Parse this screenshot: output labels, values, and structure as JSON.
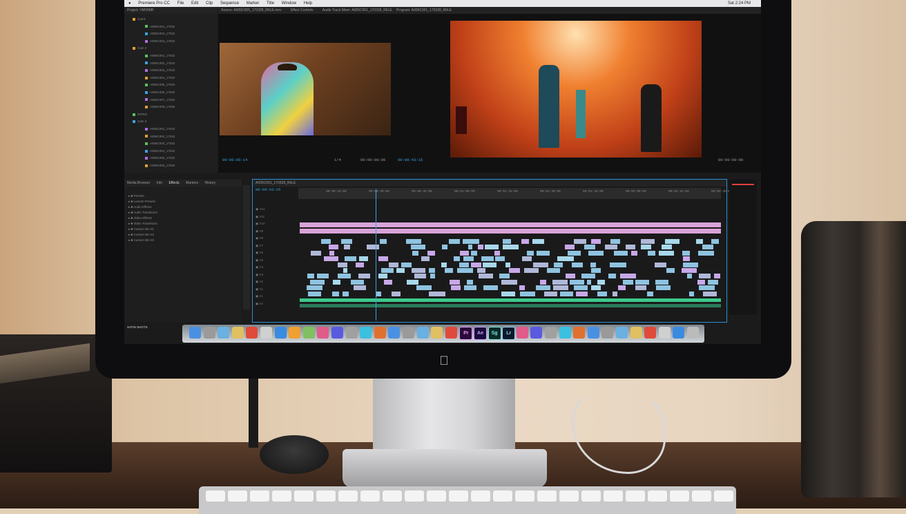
{
  "menubar": {
    "app_name": "Premiere Pro CC",
    "menus": [
      "File",
      "Edit",
      "Clip",
      "Sequence",
      "Marker",
      "Title",
      "Window",
      "Help"
    ],
    "clock": "Sat 2:24 PM"
  },
  "source_panel": {
    "tabs": [
      "Source: A005C005_170328_R6LE.mov",
      "Effect Controls",
      "Audio Track Mixer: A005C001_170328_R6LE"
    ],
    "timecode_left": "00:00:05:14",
    "timecode_right": "00:00:00:00",
    "page_fraction": "1/4"
  },
  "program_panel": {
    "title": "Program: A005C001_170328_R6LE",
    "timecode_left": "00:00:43:15",
    "timecode_right": "00:00:00:00"
  },
  "project_panel": {
    "title": "Project: VMV0MF",
    "items": [
      "Cam1",
      "A005C001_17032",
      "A005C002_17032",
      "A005C003_17032",
      "Cam 2",
      "A005C001_17032",
      "A005C002_17032",
      "A005C003_17032",
      "A005C004_17032",
      "A005C005_17032",
      "A005C006_17032",
      "A005C007_17032",
      "A005C008_17032",
      "INTRO",
      "Cam 3",
      "A005C001_17032",
      "A005C002_17032",
      "A005C003_17032",
      "A005C004_17032",
      "A005C005_17032",
      "A005C006_17032"
    ]
  },
  "lower_tabs": [
    "Media Browser",
    "Info",
    "Effects",
    "Markers",
    "History"
  ],
  "effects_list": [
    "Presets",
    "Lumetri Presets",
    "Audio Effects",
    "Audio Transitions",
    "Video Effects",
    "Video Transitions",
    "Custom Bin 01",
    "Custom Bin 02",
    "Custom Bin 03"
  ],
  "timeline": {
    "tab": "A005C001_170328_R6LE",
    "timecode": "00:00:43:15",
    "ruler_labels": [
      "00:00:15:00",
      "00:00:30:00",
      "00:00:45:00",
      "00:01:00:00",
      "00:01:15:00",
      "00:01:30:00",
      "00:01:45:00",
      "00:02:00:00",
      "00:02:15:00",
      "00:02:30:00"
    ],
    "track_labels": [
      "V12",
      "V11",
      "V10",
      "V9",
      "V8",
      "V7",
      "V6",
      "V5",
      "V4",
      "V3",
      "V2",
      "V1",
      "A1",
      "A2"
    ]
  },
  "status_text": "SATIN SHOTS",
  "dock_apps": [
    {
      "name": "Pr",
      "color": "#2a0a3a",
      "text_color": "#e59af2"
    },
    {
      "name": "Ae",
      "color": "#1a0a3a",
      "text_color": "#c5a0ff"
    },
    {
      "name": "Sg",
      "color": "#0a2a2a",
      "text_color": "#7ee8d8"
    },
    {
      "name": "Lr",
      "color": "#0a1a2a",
      "text_color": "#9ad0f2"
    }
  ]
}
